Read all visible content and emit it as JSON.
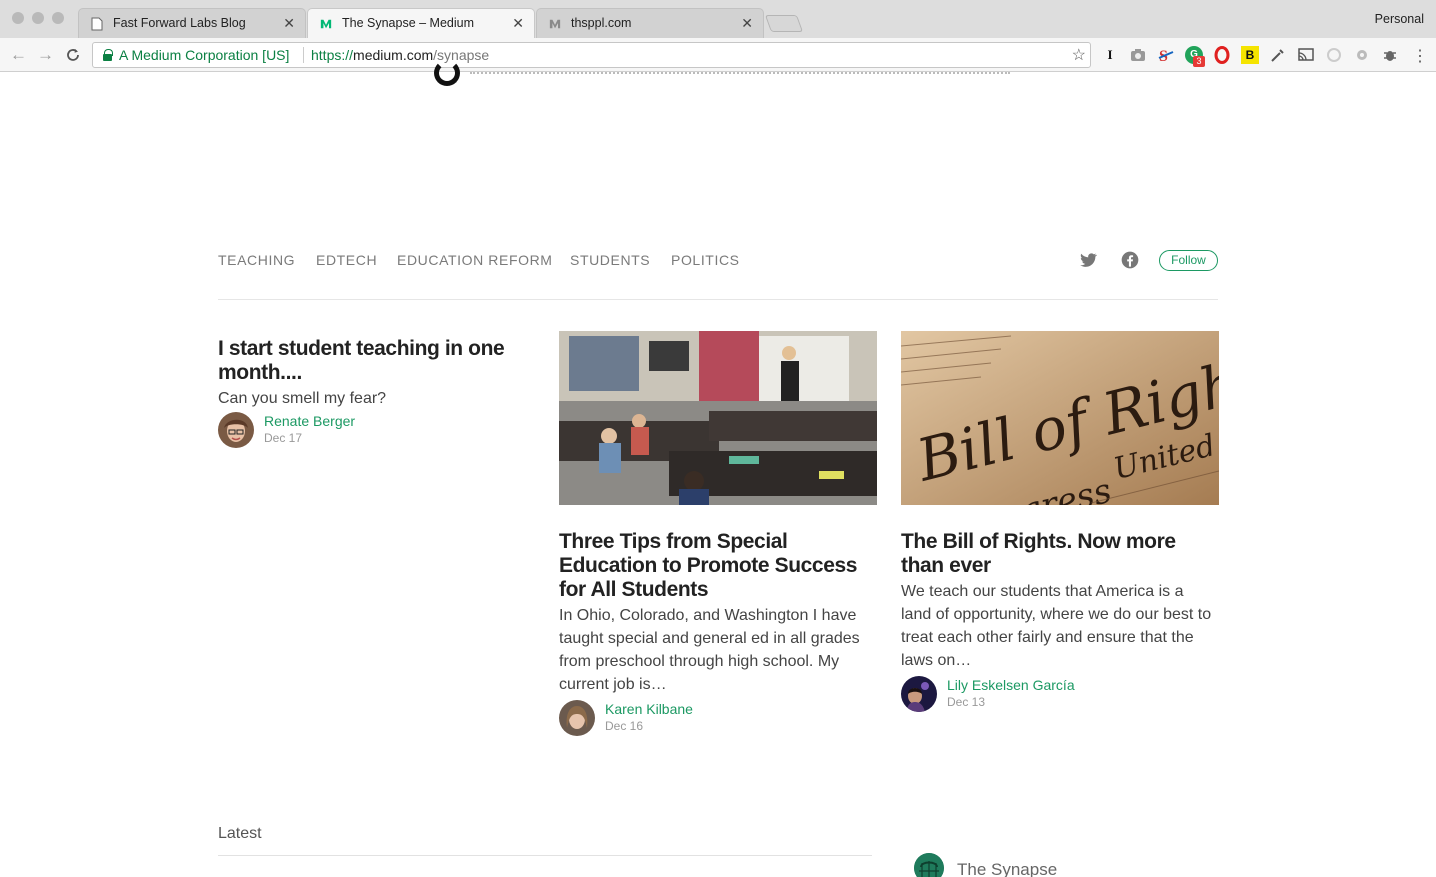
{
  "browser": {
    "tabs": [
      {
        "title": "Fast Forward Labs Blog",
        "active": false,
        "icon": "document-icon"
      },
      {
        "title": "The Synapse – Medium",
        "active": true,
        "icon": "medium-logo-icon"
      },
      {
        "title": "thsppl.com",
        "active": false,
        "icon": "medium-logo-gray-icon"
      }
    ],
    "profile": "Personal",
    "ev_label": "A Medium Corporation [US]",
    "url_protocol": "https://",
    "url_host": "medium.com",
    "url_path": "/synapse",
    "extension_badge": "3",
    "ext_labels": {
      "instapaper": "I",
      "bold": "B"
    }
  },
  "publication": {
    "nav_items": [
      "Teaching",
      "EdTech",
      "Education Reform",
      "Students",
      "Politics"
    ],
    "follow_label": "Follow",
    "brand_color": "#1c9963",
    "name": "The Synapse"
  },
  "stories": [
    {
      "title": "I start student teaching in one month....",
      "subtitle": "Can you smell my fear?",
      "author": "Renate Berger",
      "date": "Dec 17"
    },
    {
      "title": "Three Tips from Special Education to Promote Success for All Students",
      "subtitle": "In Ohio, Colorado, and Washington I have taught special and general ed in all grades from preschool through high school. My current job is…",
      "author": "Karen Kilbane",
      "date": "Dec 16",
      "image": "classroom-photo"
    },
    {
      "title": "The Bill of Rights. Now more than ever",
      "subtitle": "We teach our students that America is a land of opportunity, where we do our best to treat each other fairly and ensure that the laws on…",
      "author": "Lily Eskelsen García",
      "date": "Dec 13",
      "image": "bill-of-rights-photo"
    }
  ],
  "sections": {
    "latest": "Latest"
  }
}
